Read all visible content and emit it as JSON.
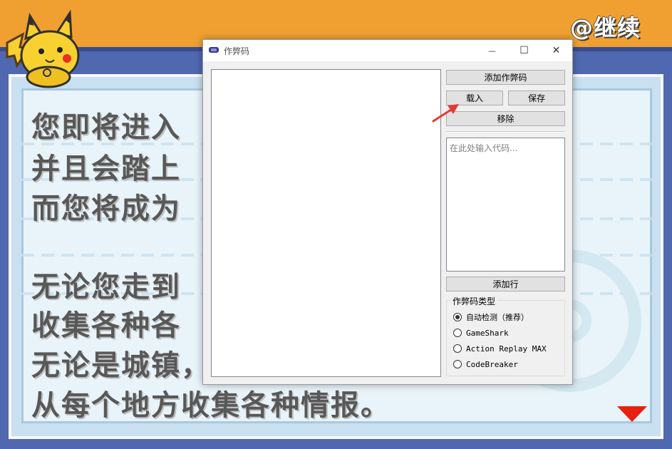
{
  "game": {
    "continue_label": "@继续",
    "lines": [
      "  您即将进入",
      "并且会踏上",
      "而您将成为",
      "无论您走到",
      "收集各种各",
      "无论是城镇，",
      "从每个地方收集各种情报。"
    ]
  },
  "dialog": {
    "title": "作弊码",
    "window_controls": {
      "minimize": "—",
      "maximize": "☐",
      "close": "✕"
    },
    "buttons": {
      "add_cheat": "添加作弊码",
      "load": "载入",
      "save": "保存",
      "remove": "移除",
      "add_line": "添加行"
    },
    "code_input_placeholder": "在此处输入代码...",
    "cheat_type": {
      "legend": "作弊码类型",
      "options": [
        {
          "label": "自动检测（推荐）",
          "checked": true
        },
        {
          "label": "GameShark",
          "checked": false
        },
        {
          "label": "Action Replay MAX",
          "checked": false
        },
        {
          "label": "CodeBreaker",
          "checked": false
        }
      ]
    }
  },
  "colors": {
    "game_top": "#f0a030",
    "game_frame": "#5068b0",
    "annotation_arrow": "#e53935"
  }
}
